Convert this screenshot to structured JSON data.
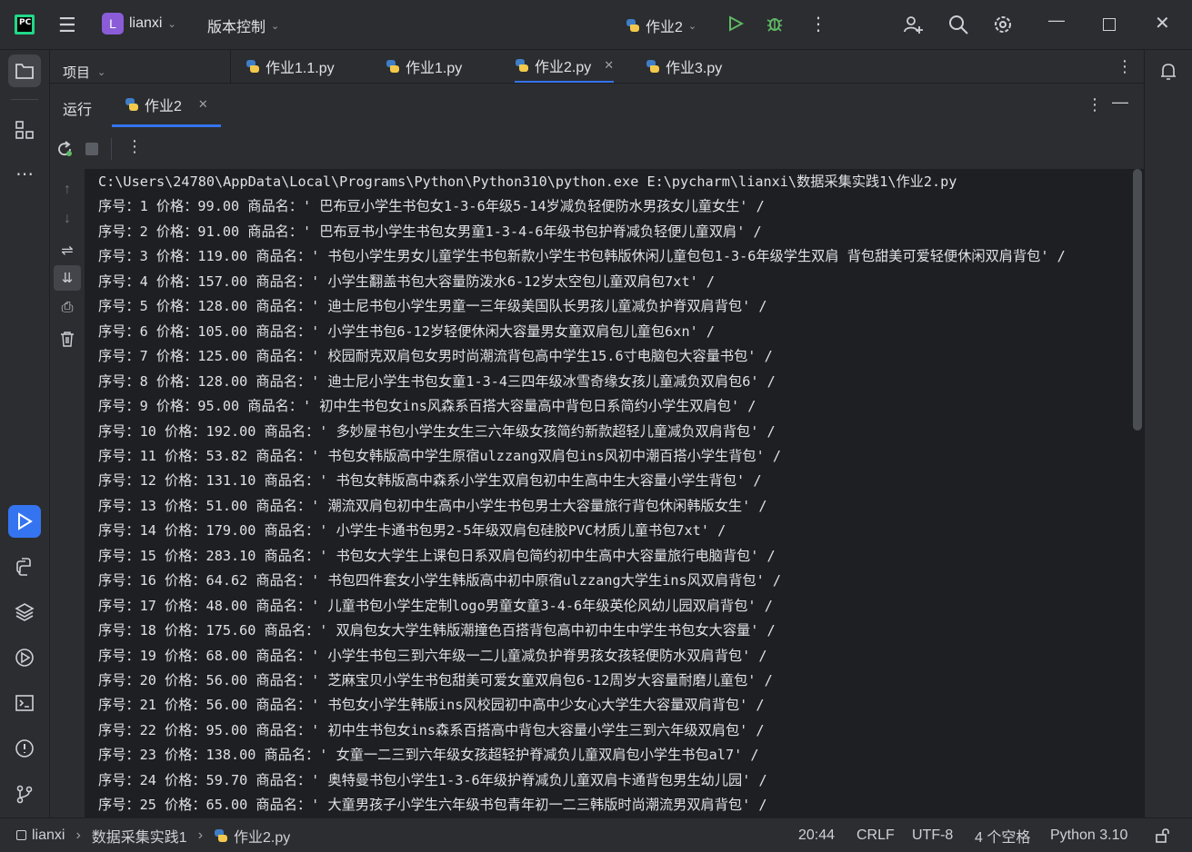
{
  "titlebar": {
    "logo_text": "PC",
    "project_badge": "L",
    "project_name": "lianxi",
    "vcs_label": "版本控制",
    "run_config": "作业2"
  },
  "left_toolbar": {
    "project_label": "项目"
  },
  "editor_tabs": [
    {
      "label": "作业1.1.py"
    },
    {
      "label": "作业1.py"
    },
    {
      "label": "作业2.py"
    },
    {
      "label": "作业3.py"
    }
  ],
  "run_panel": {
    "title": "运行",
    "tab_label": "作业2"
  },
  "console": {
    "lines": [
      "C:\\Users\\24780\\AppData\\Local\\Programs\\Python\\Python310\\python.exe E:\\pycharm\\lianxi\\数据采集实践1\\作业2.py",
      "序号：1 价格：99.00 商品名：' 巴布豆小学生书包女1-3-6年级5-14岁减负轻便防水男孩女儿童女生' /",
      "序号：2 价格：91.00 商品名：' 巴布豆书小学生书包女男童1-3-4-6年级书包护脊减负轻便儿童双肩' /",
      "序号：3 价格：119.00 商品名：' 书包小学生男女儿童学生书包新款小学生书包韩版休闲儿童包包1-3-6年级学生双肩 背包甜美可爱轻便休闲双肩背包' /",
      "序号：4 价格：157.00 商品名：' 小学生翻盖书包大容量防泼水6-12岁太空包儿童双肩包7xt' /",
      "序号：5 价格：128.00 商品名：' 迪士尼书包小学生男童一三年级美国队长男孩儿童减负护脊双肩背包' /",
      "序号：6 价格：105.00 商品名：' 小学生书包6-12岁轻便休闲大容量男女童双肩包儿童包6xn' /",
      "序号：7 价格：125.00 商品名：' 校园耐克双肩包女男时尚潮流背包高中学生15.6寸电脑包大容量书包' /",
      "序号：8 价格：128.00 商品名：' 迪士尼小学生书包女童1-3-4三四年级冰雪奇缘女孩儿童减负双肩包6' /",
      "序号：9 价格：95.00 商品名：' 初中生书包女ins风森系百搭大容量高中背包日系简约小学生双肩包' /",
      "序号：10 价格：192.00 商品名：' 多妙屋书包小学生女生三六年级女孩简约新款超轻儿童减负双肩背包' /",
      "序号：11 价格：53.82 商品名：' 书包女韩版高中学生原宿ulzzang双肩包ins风初中潮百搭小学生背包' /",
      "序号：12 价格：131.10 商品名：' 书包女韩版高中森系小学生双肩包初中生高中生大容量小学生背包' /",
      "序号：13 价格：51.00 商品名：' 潮流双肩包初中生高中小学生书包男士大容量旅行背包休闲韩版女生' /",
      "序号：14 价格：179.00 商品名：' 小学生卡通书包男2-5年级双肩包硅胶PVC材质儿童书包7xt' /",
      "序号：15 价格：283.10 商品名：' 书包女大学生上课包日系双肩包简约初中生高中大容量旅行电脑背包' /",
      "序号：16 价格：64.62 商品名：' 书包四件套女小学生韩版高中初中原宿ulzzang大学生ins风双肩背包' /",
      "序号：17 价格：48.00 商品名：' 儿童书包小学生定制logo男童女童3-4-6年级英伦风幼儿园双肩背包' /",
      "序号：18 价格：175.60 商品名：' 双肩包女大学生韩版潮撞色百搭背包高中初中生中学生书包女大容量' /",
      "序号：19 价格：68.00 商品名：' 小学生书包三到六年级一二儿童减负护脊男孩女孩轻便防水双肩背包' /",
      "序号：20 价格：56.00 商品名：' 芝麻宝贝小学生书包甜美可爱女童双肩包6-12周岁大容量耐磨儿童包' /",
      "序号：21 价格：56.00 商品名：' 书包女小学生韩版ins风校园初中高中少女心大学生大容量双肩背包' /",
      "序号：22 价格：95.00 商品名：' 初中生书包女ins森系百搭高中背包大容量小学生三到六年级双肩包' /",
      "序号：23 价格：138.00 商品名：' 女童一二三到六年级女孩超轻护脊减负儿童双肩包小学生书包al7' /",
      "序号：24 价格：59.70 商品名：' 奥特曼书包小学生1-3-6年级护脊减负儿童双肩卡通背包男生幼儿园' /",
      "序号：25 价格：65.00 商品名：' 大童男孩子小学生六年级书包青年初一二三韩版时尚潮流男双肩背包' /"
    ]
  },
  "statusbar": {
    "project": "lianxi",
    "folder": "数据采集实践1",
    "file": "作业2.py",
    "position": "20:44",
    "line_ending": "CRLF",
    "encoding": "UTF-8",
    "indent": "4 个空格",
    "interpreter": "Python 3.10"
  }
}
